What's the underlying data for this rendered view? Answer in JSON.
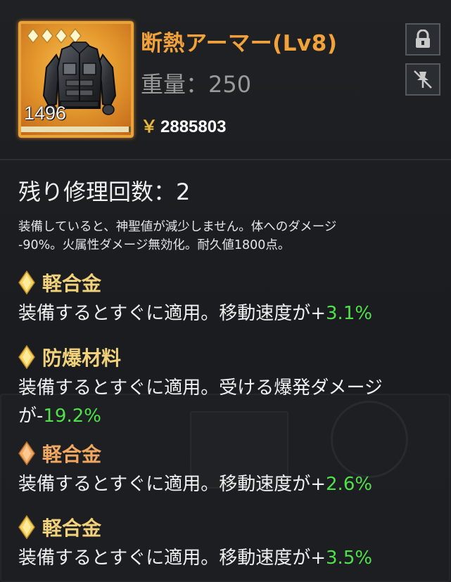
{
  "item": {
    "name": "断熱アーマー(Lv8)",
    "weight_label": "重量：",
    "weight_value": "250",
    "price_symbol": "￥",
    "price_value": "2885803",
    "durability": "1496",
    "durability_fill_fraction": 0.98,
    "star_count": 4,
    "frame_color": "#e8a33a",
    "name_color": "#f2a23a"
  },
  "actions": {
    "lock_icon": "lock-icon",
    "unpin_icon": "unpin-icon"
  },
  "repairs": {
    "label": "残り修理回数：",
    "value": "2"
  },
  "description": {
    "line1": "装備していると、神聖値が減少しません。体へのダメージ",
    "line2": "-90%。火属性ダメージ無効化。耐久値1800点。"
  },
  "mods": [
    {
      "name": "軽合金",
      "gem_color": "#f4d35e",
      "text_prefix": "装備するとすぐに適用。移動速度が+",
      "value": "3.1%"
    },
    {
      "name": "防爆材料",
      "gem_color": "#f4d35e",
      "text_line1": "装備するとすぐに適用。受ける爆発ダメージ",
      "text_prefix": "が-",
      "value": "19.2%"
    },
    {
      "name": "軽合金",
      "gem_color": "#f0a860",
      "text_prefix": "装備するとすぐに適用。移動速度が+",
      "value": "2.6%"
    },
    {
      "name": "軽合金",
      "gem_color": "#f4d35e",
      "text_prefix": "装備するとすぐに適用。移動速度が+",
      "value": "3.5%"
    }
  ],
  "colors": {
    "accent_gold": "#f1d27a",
    "accent_orange": "#f0a860",
    "positive_green": "#4fe14a"
  }
}
